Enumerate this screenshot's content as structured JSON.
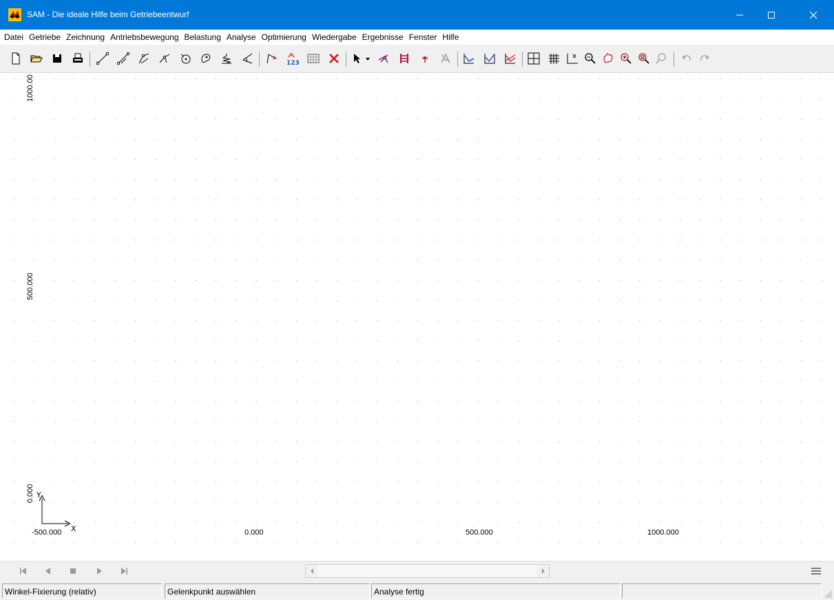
{
  "window": {
    "title": "SAM - Die ideale Hilfe beim Getriebeentwurf",
    "accent_color": "#0078d7",
    "controls": [
      "minimize-icon",
      "maximize-icon",
      "close-icon"
    ]
  },
  "menu": {
    "items": [
      "Datei",
      "Getriebe",
      "Zeichnung",
      "Antriebsbewegung",
      "Belastung",
      "Analyse",
      "Optimierung",
      "Wiedergabe",
      "Ergebnisse",
      "Fenster",
      "Hilfe"
    ]
  },
  "toolbar": {
    "buttons": [
      "new-file-icon",
      "open-folder-icon",
      "save-disk-icon",
      "print-icon",
      "beam-element-icon",
      "slider-element-icon",
      "linkage-element-icon",
      "gear-element-icon",
      "cam-element-icon",
      "spring-element-icon",
      "angle-element-icon",
      "driver-icon",
      "numbering-icon",
      "table-icon",
      "delete-icon",
      "select-pointer-icon",
      "dropdown-arrow-icon",
      "motion-icon",
      "ladder-icon",
      "force-icon",
      "disabled-mechanism-icon",
      "graph-icon-1",
      "graph-icon-2",
      "graph-icon-3",
      "grid-snap-icon",
      "grid-toggle-icon",
      "axes-toggle-icon",
      "zoom-out-icon",
      "pan-icon",
      "zoom-in-icon",
      "zoom-window-icon",
      "zoom-previous-icon",
      "undo-icon",
      "redo-icon"
    ]
  },
  "canvas": {
    "x_axis_labels": [
      "-500.000",
      "0.000",
      "500.000",
      "1000.000"
    ],
    "y_axis_labels": [
      "1000.00",
      "500.000",
      "0.000"
    ],
    "x_axis_symbol": "X",
    "y_axis_symbol": "Y"
  },
  "playback": {
    "controls": [
      "skip-to-start-icon",
      "play-backward-icon",
      "stop-icon",
      "play-forward-icon",
      "skip-to-end-icon"
    ],
    "menu_icon": "hamburger-menu-icon"
  },
  "statusbar": {
    "panel1": "Winkel-Fixierung (relativ)",
    "panel2": "Gelenkpunkt auswählen",
    "panel3": "Analyse fertig",
    "panel4": ""
  }
}
